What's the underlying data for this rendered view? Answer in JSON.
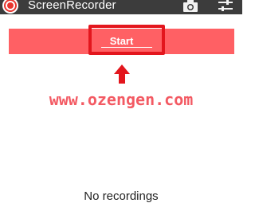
{
  "app": {
    "title": "ScreenRecorder",
    "icon": "record-icon",
    "accent_color": "#ff6064",
    "actionbar_color": "#3c3c3c"
  },
  "toolbar": {
    "actions": [
      {
        "icon": "camera-icon"
      },
      {
        "icon": "settings-sliders-icon"
      }
    ]
  },
  "main": {
    "start_label": "Start",
    "empty_text": "No recordings"
  },
  "annotation": {
    "highlight_color": "#e3161d",
    "arrow_icon": "arrow-up-icon",
    "watermark": "www.ozengen.com"
  }
}
